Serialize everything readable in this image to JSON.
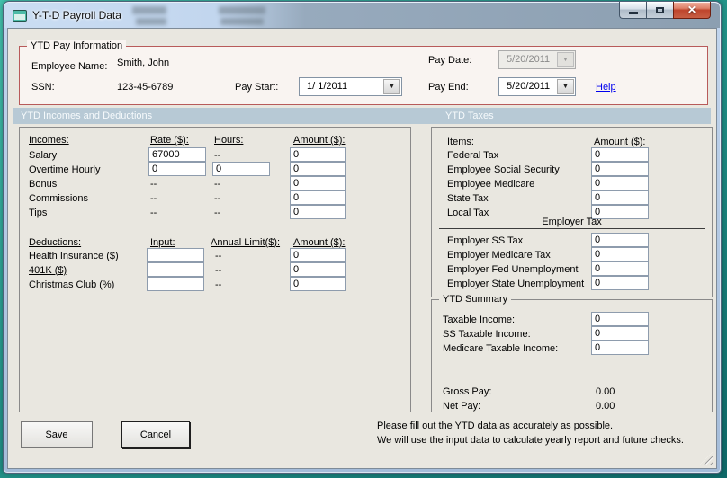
{
  "colors": {
    "desktop_teal": "#23968B",
    "titlebar_blue": "#C2D6EE",
    "section_header_bg": "#B7C9D5",
    "payinfo_border": "#B85A5A",
    "link_blue": "#0000EE",
    "close_button_red": "#BE452C"
  },
  "icons": {
    "close": "✕",
    "combo_arrow": "▼"
  },
  "window": {
    "title": "Y-T-D Payroll Data"
  },
  "pay_info": {
    "legend": "YTD Pay Information",
    "employee_name_label": "Employee Name:",
    "employee_name": "Smith, John",
    "ssn_label": "SSN:",
    "ssn": "123-45-6789",
    "pay_start_label": "Pay Start:",
    "pay_start_value": "1/ 1/2011",
    "pay_date_label": "Pay Date:",
    "pay_date_value": "5/20/2011",
    "pay_end_label": "Pay End:",
    "pay_end_value": "5/20/2011",
    "help_label": "Help"
  },
  "sections": {
    "left_header": "YTD Incomes and Deductions",
    "right_header": "YTD Taxes"
  },
  "incomes": {
    "headers": {
      "c1": "Incomes:",
      "c2": "Rate ($):",
      "c3": "Hours:",
      "c4": "Amount ($):"
    },
    "rows": [
      {
        "label": "Salary",
        "rate": "67000",
        "hours": "--",
        "amount": "0"
      },
      {
        "label": "Overtime Hourly",
        "rate": "0",
        "hours": "0",
        "amount": "0"
      },
      {
        "label": "Bonus",
        "rate": "--",
        "hours": "--",
        "amount": "0"
      },
      {
        "label": "Commissions",
        "rate": "--",
        "hours": "--",
        "amount": "0"
      },
      {
        "label": "Tips",
        "rate": "--",
        "hours": "--",
        "amount": "0"
      }
    ]
  },
  "deductions": {
    "headers": {
      "c1": "Deductions:",
      "c2": "Input:",
      "c3": "Annual Limit($):",
      "c4": "Amount ($):"
    },
    "rows": [
      {
        "label": "Health Insurance  ($)",
        "input": "",
        "limit": "--",
        "amount": "0"
      },
      {
        "label": "401K  ($)",
        "input": "",
        "limit": "--",
        "amount": "0"
      },
      {
        "label": "Christmas Club  (%)",
        "input": "",
        "limit": "--",
        "amount": "0"
      }
    ]
  },
  "taxes": {
    "headers": {
      "items": "Items:",
      "amount": "Amount ($):"
    },
    "employee_rows": [
      {
        "label": "Federal Tax",
        "amount": "0"
      },
      {
        "label": "Employee Social Security",
        "amount": "0"
      },
      {
        "label": "Employee Medicare",
        "amount": "0"
      },
      {
        "label": "State Tax",
        "amount": "0"
      },
      {
        "label": "Local Tax",
        "amount": "0"
      }
    ],
    "employer_header": "Employer Tax",
    "employer_rows": [
      {
        "label": "Employer SS Tax",
        "amount": "0"
      },
      {
        "label": "Employer Medicare Tax",
        "amount": "0"
      },
      {
        "label": "Employer Fed Unemployment",
        "amount": "0"
      },
      {
        "label": "Employer State Unemployment",
        "amount": "0"
      }
    ]
  },
  "summary": {
    "legend": "YTD Summary",
    "rows": [
      {
        "label": "Taxable Income:",
        "value": "0"
      },
      {
        "label": "SS Taxable Income:",
        "value": "0"
      },
      {
        "label": "Medicare Taxable Income:",
        "value": "0"
      }
    ],
    "gross_pay_label": "Gross Pay:",
    "gross_pay_value": "0.00",
    "net_pay_label": "Net Pay:",
    "net_pay_value": "0.00"
  },
  "footer": {
    "save_label": "Save",
    "cancel_label": "Cancel",
    "note_line1": "Please fill out the YTD data as accurately as possible.",
    "note_line2": "We will use the input data to calculate yearly report and future checks."
  }
}
